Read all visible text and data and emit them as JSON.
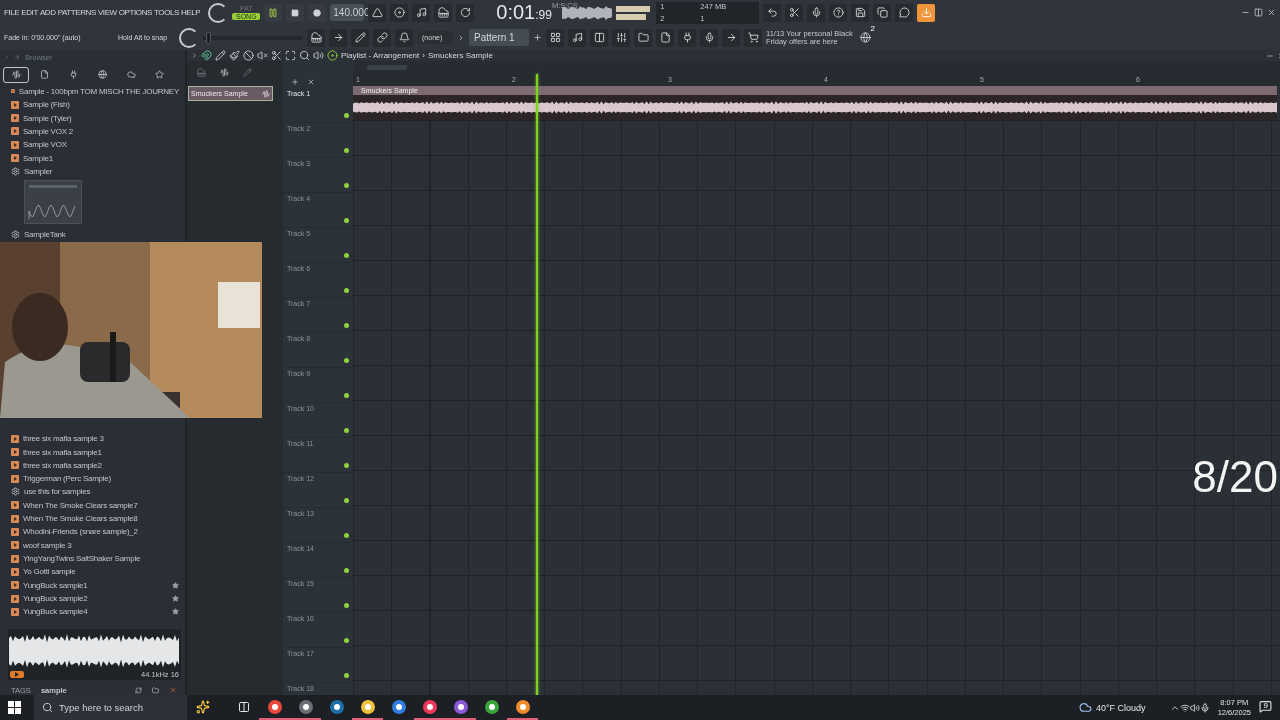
{
  "menu": [
    "FILE",
    "EDIT",
    "ADD",
    "PATTERNS",
    "VIEW",
    "OPTIONS",
    "TOOLS",
    "HELP"
  ],
  "modes": [
    {
      "label": "PAT",
      "selected": false
    },
    {
      "label": "SONG",
      "selected": true
    }
  ],
  "tempo": "140.000",
  "time": {
    "value": "0:01",
    "fraction": ":99",
    "unit": "M:S:CS"
  },
  "monitor": {
    "polyphony": "1",
    "cpu": "2",
    "memory": "247 MB",
    "voices": "1"
  },
  "hint": {
    "text": "Fade in: 0'00.000\" (auto)",
    "snap": "Hold Alt to snap"
  },
  "master_slider": {
    "level": 0.06
  },
  "snap_mode": "(none)",
  "pattern": "Pattern 1",
  "news": {
    "count": "11/13",
    "text": "Your personal Black Friday offers are here",
    "badge": "2"
  },
  "browser": {
    "title": "Browser",
    "tabs": [
      {
        "kind": "all",
        "selected": true
      },
      {
        "kind": "files",
        "selected": false
      },
      {
        "kind": "plugins",
        "selected": false
      },
      {
        "kind": "online",
        "selected": false
      },
      {
        "kind": "cloud",
        "selected": false
      },
      {
        "kind": "favorites",
        "selected": false
      }
    ],
    "items_top": [
      {
        "kind": "sample",
        "label": "Sample - 100bpm TOM MISCH THE JOURNEY",
        "starred": false
      },
      {
        "kind": "sample",
        "label": "Sample (Fish)",
        "starred": false
      },
      {
        "kind": "sample",
        "label": "Sample (Tyler)",
        "starred": false
      },
      {
        "kind": "sample",
        "label": "Sample VOX 2",
        "starred": false
      },
      {
        "kind": "sample",
        "label": "Sample VOX",
        "starred": false
      },
      {
        "kind": "sample",
        "label": "Sample1",
        "starred": false
      },
      {
        "kind": "plugin",
        "label": "Sampler",
        "starred": false,
        "thumbnail": true
      },
      {
        "kind": "plugin",
        "label": "SampleTank",
        "starred": false
      }
    ],
    "items_bottom": [
      {
        "kind": "sample",
        "label": "three six mafia sample 3",
        "starred": false
      },
      {
        "kind": "sample",
        "label": "three six mafia sample1",
        "starred": false
      },
      {
        "kind": "sample",
        "label": "three six mafia sample2",
        "starred": false
      },
      {
        "kind": "sample",
        "label": "Triggerman (Perc Sample)",
        "starred": false
      },
      {
        "kind": "plugin",
        "label": "use this for samples",
        "starred": false
      },
      {
        "kind": "sample",
        "label": "When The Smoke Clears sample7",
        "starred": false
      },
      {
        "kind": "sample",
        "label": "When The Smoke Clears sample8",
        "starred": false
      },
      {
        "kind": "sample",
        "label": "Whodini-Friends (snare sample)_2",
        "starred": false
      },
      {
        "kind": "sample",
        "label": "woof sample 3",
        "starred": false
      },
      {
        "kind": "sample",
        "label": "YingYangTwins SaltShaker Sample",
        "starred": false
      },
      {
        "kind": "sample",
        "label": "Yo Gotti sample",
        "starred": false
      },
      {
        "kind": "sample",
        "label": "YungBuck sample1",
        "starred": true
      },
      {
        "kind": "sample",
        "label": "YungBuck sample2",
        "starred": true
      },
      {
        "kind": "sample",
        "label": "YungBuck sample4",
        "starred": true
      }
    ],
    "preview_info": "44.1kHz 16",
    "tags": {
      "label": "TAGS",
      "value": "sample"
    }
  },
  "playlist": {
    "title": "Playlist - Arrangement",
    "separator": "›",
    "crumb": "Smuckers Sample",
    "picker": [
      "Smuckers Sample"
    ],
    "bars": [
      "1",
      "2",
      "3",
      "4",
      "5",
      "6"
    ],
    "tracks": [
      {
        "name": "Track 1",
        "selected": true
      },
      {
        "name": "Track 2",
        "selected": false
      },
      {
        "name": "Track 3",
        "selected": false
      },
      {
        "name": "Track 4",
        "selected": false
      },
      {
        "name": "Track 5",
        "selected": false
      },
      {
        "name": "Track 6",
        "selected": false
      },
      {
        "name": "Track 7",
        "selected": false
      },
      {
        "name": "Track 8",
        "selected": false
      },
      {
        "name": "Track 9",
        "selected": false
      },
      {
        "name": "Track 10",
        "selected": false
      },
      {
        "name": "Track 11",
        "selected": false
      },
      {
        "name": "Track 12",
        "selected": false
      },
      {
        "name": "Track 13",
        "selected": false
      },
      {
        "name": "Track 14",
        "selected": false
      },
      {
        "name": "Track 15",
        "selected": false
      },
      {
        "name": "Track 16",
        "selected": false
      },
      {
        "name": "Track 17",
        "selected": false
      },
      {
        "name": "Track 18",
        "selected": false
      }
    ],
    "clip": "Smuckers Sample",
    "playhead": {
      "level": 0.195
    }
  },
  "counter": "8/20",
  "taskbar": {
    "search_placeholder": "Type here to search",
    "apps": [
      {
        "kind": "chrome",
        "open": true
      },
      {
        "kind": "recorder",
        "open": true
      },
      {
        "kind": "steam",
        "open": false
      },
      {
        "kind": "folder",
        "open": true
      },
      {
        "kind": "store",
        "open": false
      },
      {
        "kind": "music",
        "open": true
      },
      {
        "kind": "chat",
        "open": true
      },
      {
        "kind": "xbox",
        "open": false
      },
      {
        "kind": "daw",
        "open": true
      }
    ],
    "weather": "40°F Cloudy",
    "time": "8:07 PM",
    "date": "12/6/2025",
    "notifications": "9"
  }
}
